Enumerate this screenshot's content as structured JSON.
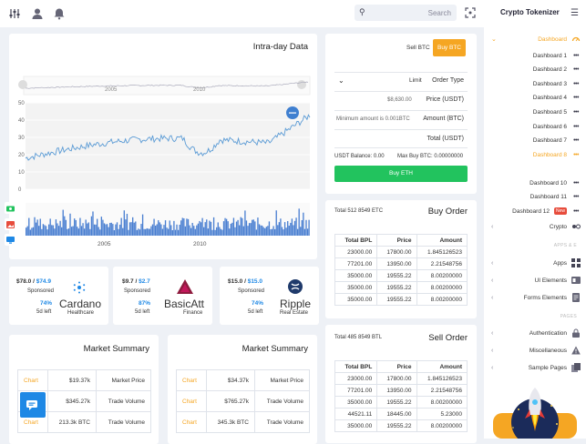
{
  "topbar": {
    "search_placeholder": "Search"
  },
  "sidebar": {
    "brand": "Crypto Tokenizer",
    "dashboard_label": "Dashboard",
    "items": [
      "Dashboard 1",
      "Dashboard 2",
      "Dashboard 3",
      "Dashboard 4",
      "Dashboard 5",
      "Dashboard 6",
      "Dashboard 7",
      "Dashboard 8",
      "Dashboard 10",
      "Dashboard 11",
      "Dashboard 12"
    ],
    "new_badge": "New",
    "crypto": "Crypto",
    "apps_section": "APPS & E",
    "apps": "Apps",
    "ui_elements": "UI Elements",
    "form_elements": "Forms Elements",
    "pages_section": "PAGES",
    "authentication": "Authentication",
    "miscellaneous": "Miscellaneous",
    "sample_pages": "Sample Pages"
  },
  "intraday": {
    "title": "Intra-day Data",
    "nav_labels": [
      "2005",
      "2010"
    ],
    "bottom_labels": [
      "2005",
      "2010"
    ]
  },
  "chart_data": {
    "type": "line",
    "title": "Intra-day Data",
    "ylim": [
      0,
      50
    ],
    "yticks": [
      "0",
      "10",
      "20",
      "30",
      "40",
      "50"
    ],
    "xticks": [
      "2005",
      "2010"
    ],
    "note": "Main area is a line series with a volume bar series beneath."
  },
  "trade": {
    "sell_btc": "Sell BTC",
    "buy_btc": "Buy BTC",
    "limit": "Limit",
    "order_type": "Order Type",
    "price_value": "$8,630.00",
    "price_label": "Price (USDT)",
    "amount_hint": "Minimum amount is 0.001BTC",
    "amount_label": "Amount (BTC)",
    "total_label": "Total (USDT)",
    "usdt_balance": "USDT Balance: 0.00",
    "max_buy": "Max Buy BTC: 0.00000000",
    "buy_eth": "Buy ETH"
  },
  "buy_order": {
    "title": "Buy Order",
    "total": "Total 512 8549 ETC",
    "headers": [
      "Total BPL",
      "Price",
      "Amount"
    ],
    "rows": [
      [
        "23000.00",
        "17800.00",
        "1.845126523"
      ],
      [
        "77201.00",
        "13950.00",
        "2.21548756"
      ],
      [
        "35000.00",
        "19555.22",
        "8.00200000"
      ],
      [
        "35000.00",
        "19555.22",
        "8.00200000"
      ],
      [
        "35000.00",
        "19555.22",
        "8.00200000"
      ]
    ]
  },
  "sell_order": {
    "title": "Sell Order",
    "total": "Total 485 8549 BTL",
    "headers": [
      "Total BPL",
      "Price",
      "Amount"
    ],
    "rows": [
      [
        "23000.00",
        "17800.00",
        "1.845126523"
      ],
      [
        "77201.00",
        "13950.00",
        "2.21548756"
      ],
      [
        "35000.00",
        "19555.22",
        "8.00200000"
      ],
      [
        "44521.11",
        "18445.00",
        "5.23000"
      ],
      [
        "35000.00",
        "19555.22",
        "8.00200000"
      ]
    ]
  },
  "stats": [
    {
      "price_old": "$78.0 /",
      "price_new": "$74.9",
      "sponsored": "Sponsored",
      "pct": "74%",
      "days": "5d left",
      "name": "Cardano",
      "sub": "Healthcare"
    },
    {
      "price_old": "$9.7 /",
      "price_new": "$2.7",
      "sponsored": "Sponsored",
      "pct": "87%",
      "days": "5d left",
      "name": "BasicAtt",
      "sub": "Finance"
    },
    {
      "price_old": "$15.0 /",
      "price_new": "$15.0",
      "sponsored": "Sponsored",
      "pct": "74%",
      "days": "5d left",
      "name": "Ripple",
      "sub": "Real Estate"
    }
  ],
  "market1": {
    "title": "Market Summary",
    "rows": [
      [
        "Chart",
        "$19.37k",
        "Market Price"
      ],
      [
        "",
        "$345.27k",
        "Trade Volume"
      ],
      [
        "Chart",
        "213.3k BTC",
        "Trade Volume"
      ]
    ]
  },
  "market2": {
    "title": "Market Summary",
    "rows": [
      [
        "Chart",
        "$34.37k",
        "Market Price"
      ],
      [
        "Chart",
        "$765.27k",
        "Trade Volume"
      ],
      [
        "Chart",
        "345.3k BTC",
        "Trade Volume"
      ]
    ]
  },
  "colors": {
    "accent": "#f5a623",
    "green": "#22c35e",
    "blue": "#1e88e5",
    "line": "#5b9bd5"
  }
}
